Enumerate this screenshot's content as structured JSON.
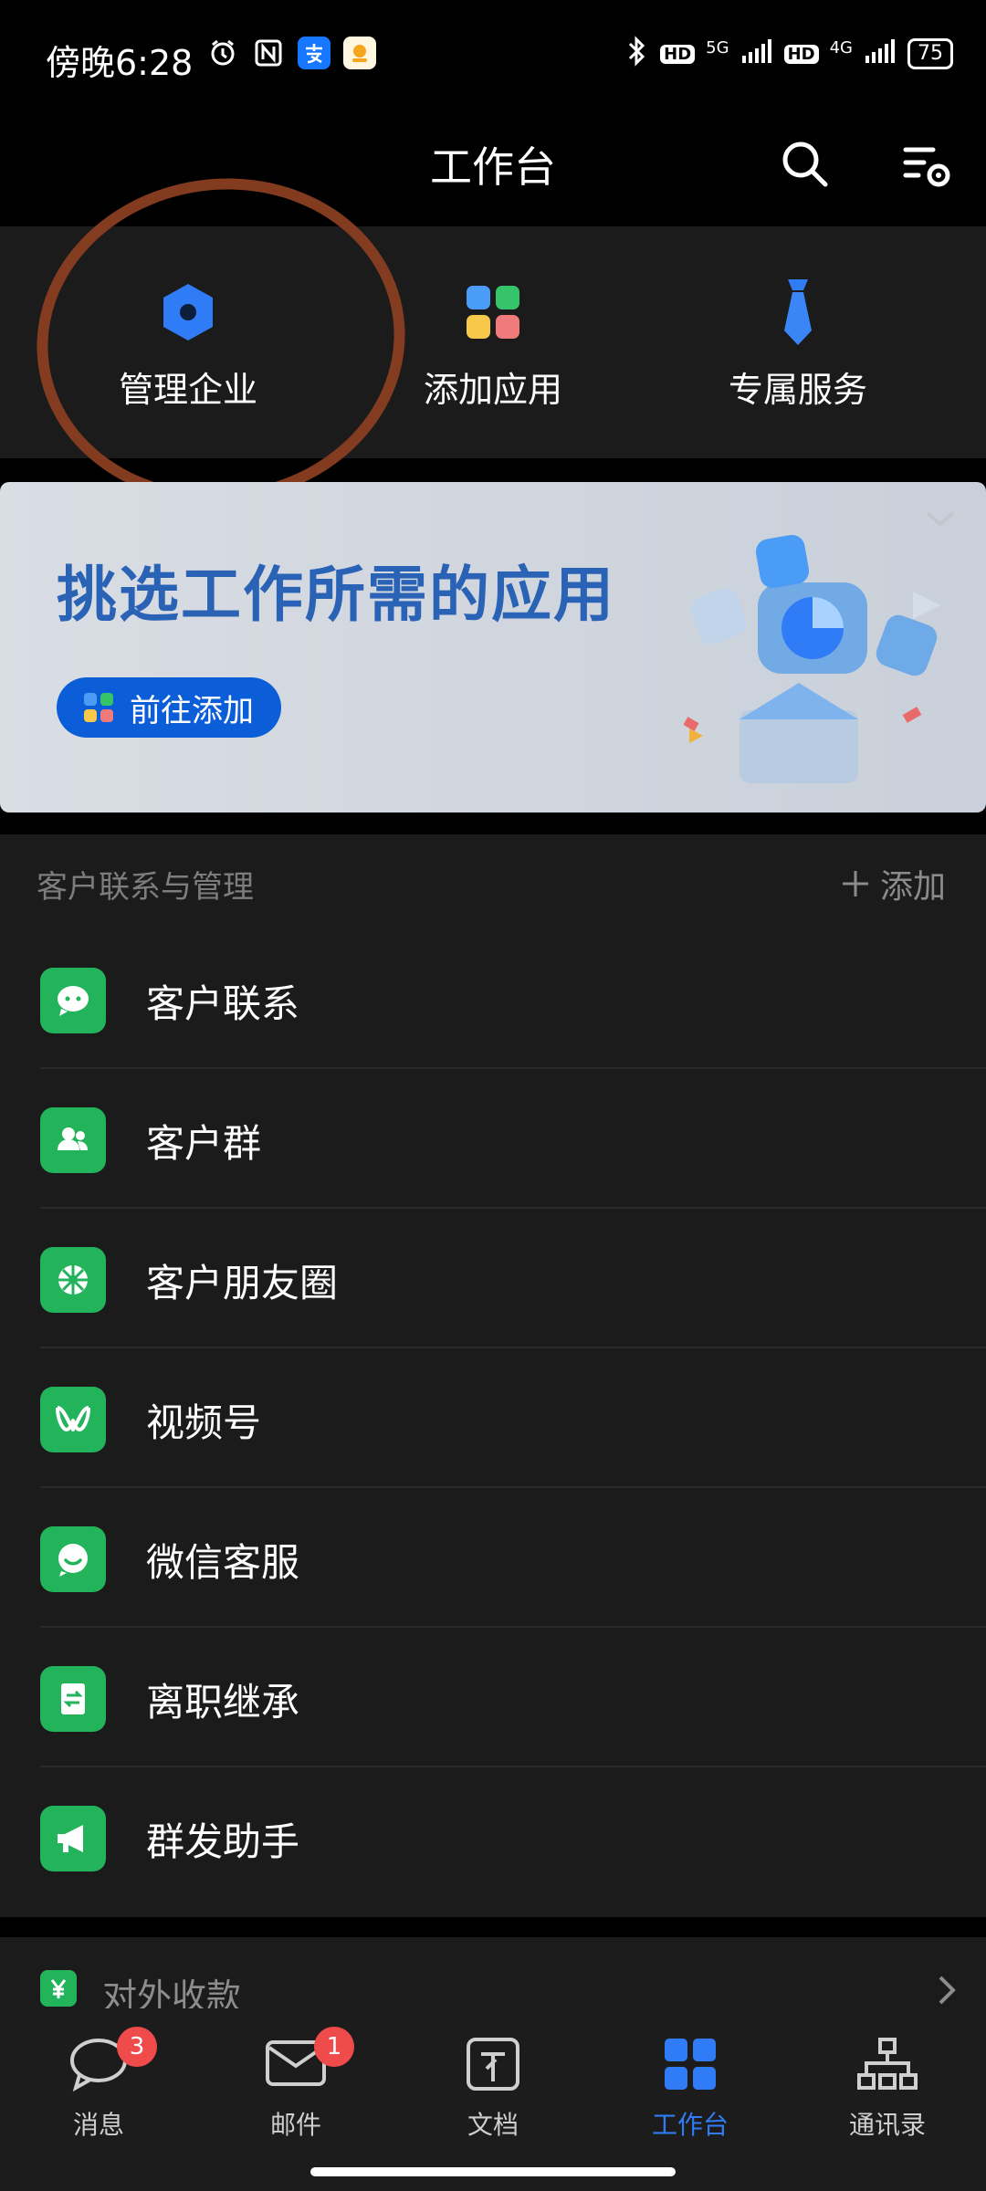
{
  "statusbar": {
    "time": "傍晚6:28",
    "icons": [
      "alarm-icon",
      "nfc-icon",
      "alipay-icon",
      "app-icon"
    ],
    "signal_labels": [
      "HD",
      "5G",
      "HD",
      "4G"
    ],
    "battery": "75"
  },
  "header": {
    "title": "工作台",
    "actions": [
      "search-icon",
      "settings-icon"
    ]
  },
  "quick_actions": [
    {
      "label": "管理企业",
      "icon": "hexagon-icon",
      "color": "#2f7cf6"
    },
    {
      "label": "添加应用",
      "icon": "apps-grid-icon"
    },
    {
      "label": "专属服务",
      "icon": "tie-icon",
      "color": "#2f7cf6"
    }
  ],
  "banner": {
    "title": "挑选工作所需的应用",
    "button_label": "前往添加"
  },
  "customer_section": {
    "heading": "客户联系与管理",
    "add_label": "添加",
    "items": [
      {
        "label": "客户联系",
        "icon": "chat-icon"
      },
      {
        "label": "客户群",
        "icon": "group-icon"
      },
      {
        "label": "客户朋友圈",
        "icon": "moments-icon"
      },
      {
        "label": "视频号",
        "icon": "channels-icon"
      },
      {
        "label": "微信客服",
        "icon": "service-icon"
      },
      {
        "label": "离职继承",
        "icon": "transfer-icon"
      },
      {
        "label": "群发助手",
        "icon": "megaphone-icon"
      }
    ]
  },
  "next_section": {
    "label": "对外收款",
    "icon": "yuan-icon"
  },
  "tabbar": {
    "tabs": [
      {
        "label": "消息",
        "badge": "3",
        "icon": "message-icon"
      },
      {
        "label": "邮件",
        "badge": "1",
        "icon": "mail-icon"
      },
      {
        "label": "文档",
        "icon": "document-icon"
      },
      {
        "label": "工作台",
        "icon": "workbench-icon",
        "active": true
      },
      {
        "label": "通讯录",
        "icon": "contacts-icon"
      }
    ]
  },
  "colors": {
    "accent": "#2f7cf6",
    "green": "#22b35b",
    "badge": "#ef4b4b"
  }
}
